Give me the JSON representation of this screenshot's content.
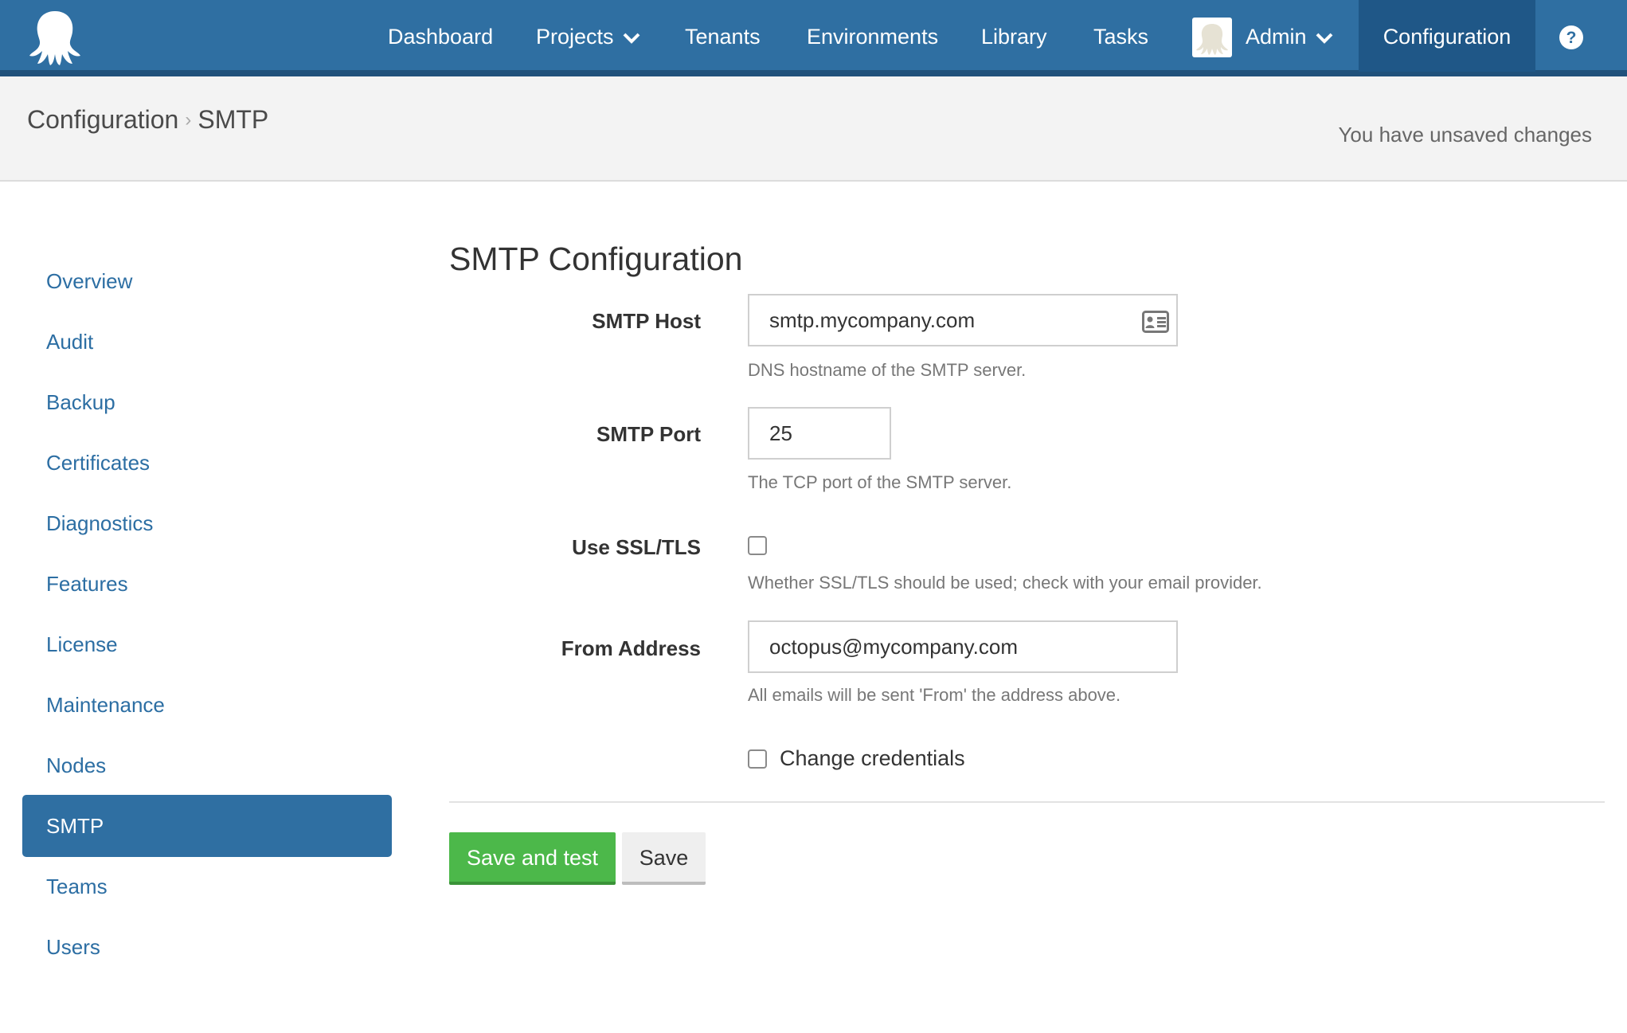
{
  "nav": {
    "items": [
      {
        "label": "Dashboard"
      },
      {
        "label": "Projects"
      },
      {
        "label": "Tenants"
      },
      {
        "label": "Environments"
      },
      {
        "label": "Library"
      },
      {
        "label": "Tasks"
      }
    ],
    "user_label": "Admin",
    "active_label": "Configuration",
    "help_icon": "question-circle-icon",
    "brand_color": "#2f6fa2"
  },
  "breadcrumb": {
    "parent": "Configuration",
    "separator": "›",
    "current": "SMTP"
  },
  "status": {
    "unsaved": "You have unsaved changes"
  },
  "sidebar": {
    "items": [
      {
        "label": "Overview"
      },
      {
        "label": "Audit"
      },
      {
        "label": "Backup"
      },
      {
        "label": "Certificates"
      },
      {
        "label": "Diagnostics"
      },
      {
        "label": "Features"
      },
      {
        "label": "License"
      },
      {
        "label": "Maintenance"
      },
      {
        "label": "Nodes"
      },
      {
        "label": "SMTP"
      },
      {
        "label": "Teams"
      },
      {
        "label": "Users"
      }
    ],
    "active": "SMTP"
  },
  "form": {
    "title": "SMTP Configuration",
    "host": {
      "label": "SMTP Host",
      "value": "smtp.mycompany.com",
      "help": "DNS hostname of the SMTP server."
    },
    "port": {
      "label": "SMTP Port",
      "value": "25",
      "help": "The TCP port of the SMTP server."
    },
    "ssl": {
      "label": "Use SSL/TLS",
      "checked": false,
      "help": "Whether SSL/TLS should be used; check with your email provider."
    },
    "from": {
      "label": "From Address",
      "value": "octopus@mycompany.com",
      "help": "All emails will be sent 'From' the address above."
    },
    "credentials": {
      "label": "Change credentials",
      "checked": false
    }
  },
  "actions": {
    "save_test": "Save and test",
    "save": "Save",
    "save_test_color": "#4cb84a"
  }
}
